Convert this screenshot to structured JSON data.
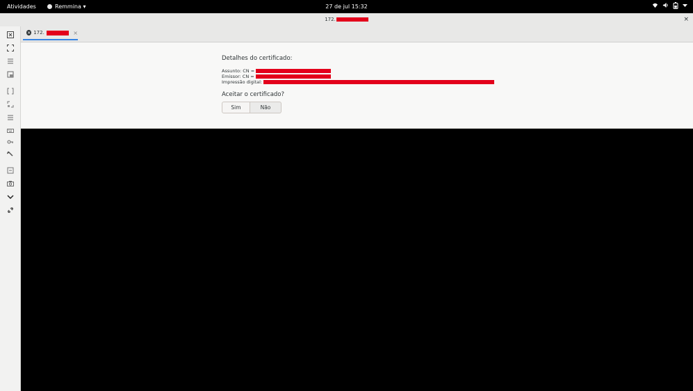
{
  "topbar": {
    "activities": "Atividades",
    "app_name": "Remmina ▾",
    "clock": "27 de jul 15:32",
    "tray": [
      "wifi-icon",
      "volume-icon",
      "battery-icon",
      "chevron-down-icon"
    ]
  },
  "window": {
    "title": "172.",
    "close": "×"
  },
  "sidebar": {
    "icons": [
      "fullscreen-icon",
      "fit-window-icon",
      "menu-icon",
      "scale-icon",
      "dynamic-resolution-icon",
      "scaled-mode-icon",
      "preferences-icon",
      "keyboard-icon",
      "keys-icon",
      "tools-icon",
      "duplicate-icon",
      "screenshot-icon",
      "minimize-icon",
      "disconnect-icon"
    ]
  },
  "tab": {
    "label": "172.",
    "close": "×"
  },
  "certificate": {
    "title": "Detalhes do certificado:",
    "subject_label": "Assunto: CN =",
    "issuer_label": "Emissor: CN =",
    "fingerprint_label": "Impressão digital:",
    "question": "Aceitar o certificado?",
    "yes": "Sim",
    "no": "Não"
  },
  "colors": {
    "redaction": "#e3001b",
    "accent": "#3584e4"
  }
}
